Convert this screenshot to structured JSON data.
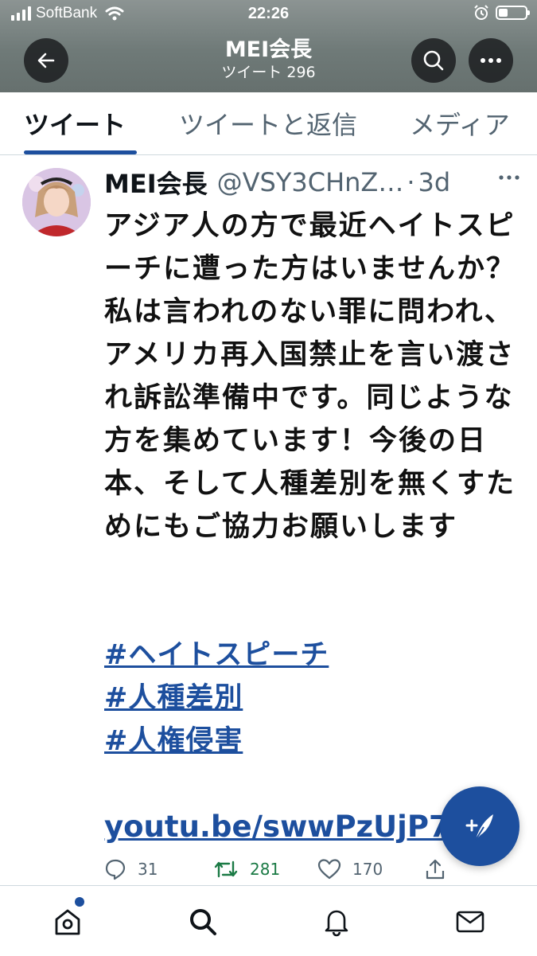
{
  "status_bar": {
    "carrier": "SoftBank",
    "time": "22:26",
    "battery_level": 0.35
  },
  "header": {
    "title": "MEI会長",
    "subtitle": "ツイート 296",
    "back_icon": "arrow-left-icon",
    "search_icon": "search-icon",
    "more_icon": "more-icon"
  },
  "tabs": [
    {
      "label": "ツイート",
      "active": true
    },
    {
      "label": "ツイートと返信",
      "active": false
    },
    {
      "label": "メディア",
      "active": false
    }
  ],
  "tweet": {
    "name": "MEI会長",
    "handle": "@VSY3CHnZ…",
    "dot": "·",
    "age": "3d",
    "text": "アジア人の方で最近ヘイトスピーチに遭った方はいませんか？\n私は言われのない罪に問われ、アメリカ再入国禁止を言い渡され訴訟準備中です。同じような方を集めています！今後の日本、そして人種差別を無くすためにもご協力お願いします",
    "hashtags": [
      "#ヘイトスピーチ",
      "#人種差別",
      "#人権侵害"
    ],
    "link": "youtu.be/swwPzUjP7",
    "replies": "31",
    "retweets": "281",
    "likes": "170"
  },
  "colors": {
    "accent": "#1d4f9e",
    "retweet": "#1b7a45",
    "muted": "#536471"
  },
  "fab": {
    "icon": "compose-icon"
  },
  "bottom_nav": [
    "home-icon",
    "search-icon",
    "bell-icon",
    "mail-icon"
  ]
}
